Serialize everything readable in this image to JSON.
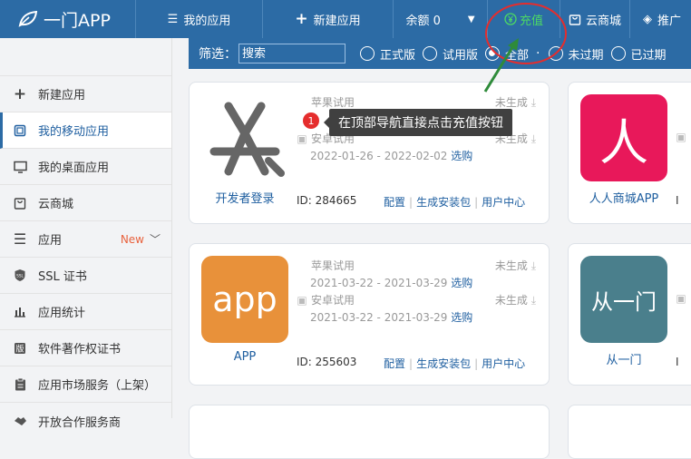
{
  "topbar": {
    "logo": "一门APP",
    "nav": [
      {
        "label": "我的应用",
        "icon": "list-icon"
      },
      {
        "label": "新建应用",
        "icon": "plus-icon"
      },
      {
        "label": "余额 0",
        "icon": "caret-down-icon"
      },
      {
        "label": "充值",
        "icon": "yen-circle-icon"
      },
      {
        "label": "云商城",
        "icon": "bag-icon"
      },
      {
        "label": "推广",
        "icon": "diamond-icon"
      }
    ]
  },
  "sidebar": {
    "items": [
      {
        "label": "新建应用",
        "icon": "plus-icon"
      },
      {
        "label": "我的移动应用",
        "icon": "mobile-icon"
      },
      {
        "label": "我的桌面应用",
        "icon": "monitor-icon"
      },
      {
        "label": "云商城",
        "icon": "bag-icon"
      },
      {
        "label": "应用",
        "icon": "menu-icon",
        "badge": "New"
      },
      {
        "label": "SSL 证书",
        "icon": "ssl-icon"
      },
      {
        "label": "应用统计",
        "icon": "bar-chart-icon"
      },
      {
        "label": "软件著作权证书",
        "icon": "copyright-icon"
      },
      {
        "label": "应用市场服务（上架）",
        "icon": "clipboard-icon"
      },
      {
        "label": "开放合作服务商",
        "icon": "handshake-icon"
      }
    ]
  },
  "filter": {
    "label": "筛选：",
    "placeholder": "搜索",
    "options": [
      "正式版",
      "试用版",
      "全部",
      "未过期",
      "已过期"
    ],
    "selected": "全部",
    "dot": "·"
  },
  "cards": [
    {
      "name": "开发者登录",
      "ios_label": "苹果试用",
      "android_label": "安卓试用",
      "ios_status": "未生成",
      "android_status": "未生成",
      "android_dates": "2022-01-26 - 2022-02-02",
      "select": "选购",
      "id": "ID: 284665",
      "actions": [
        "配置",
        "生成安装包",
        "用户中心"
      ]
    },
    {
      "name": "人人商城APP",
      "icon_text": "人"
    },
    {
      "name": "APP",
      "icon_text": "app",
      "ios_label": "苹果试用",
      "android_label": "安卓试用",
      "ios_status": "未生成",
      "android_status": "未生成",
      "ios_dates": "2021-03-22 - 2021-03-29",
      "android_dates": "2021-03-22 - 2021-03-29",
      "select": "选购",
      "id": "ID: 255603",
      "actions": [
        "配置",
        "生成安装包",
        "用户中心"
      ]
    },
    {
      "name": "从一门",
      "icon_text": "从一门"
    }
  ],
  "tooltip": {
    "step": "1",
    "text": "在顶部导航直接点击充值按钮"
  },
  "colors": {
    "nav_bg": "#2c6ba5",
    "recharge": "#4cd964",
    "annotation_red": "#e52d2d",
    "arrow_green": "#2e8b3a",
    "icon_pink": "#e8185a",
    "icon_orange": "#e8913a",
    "icon_teal": "#4a7f8c"
  }
}
